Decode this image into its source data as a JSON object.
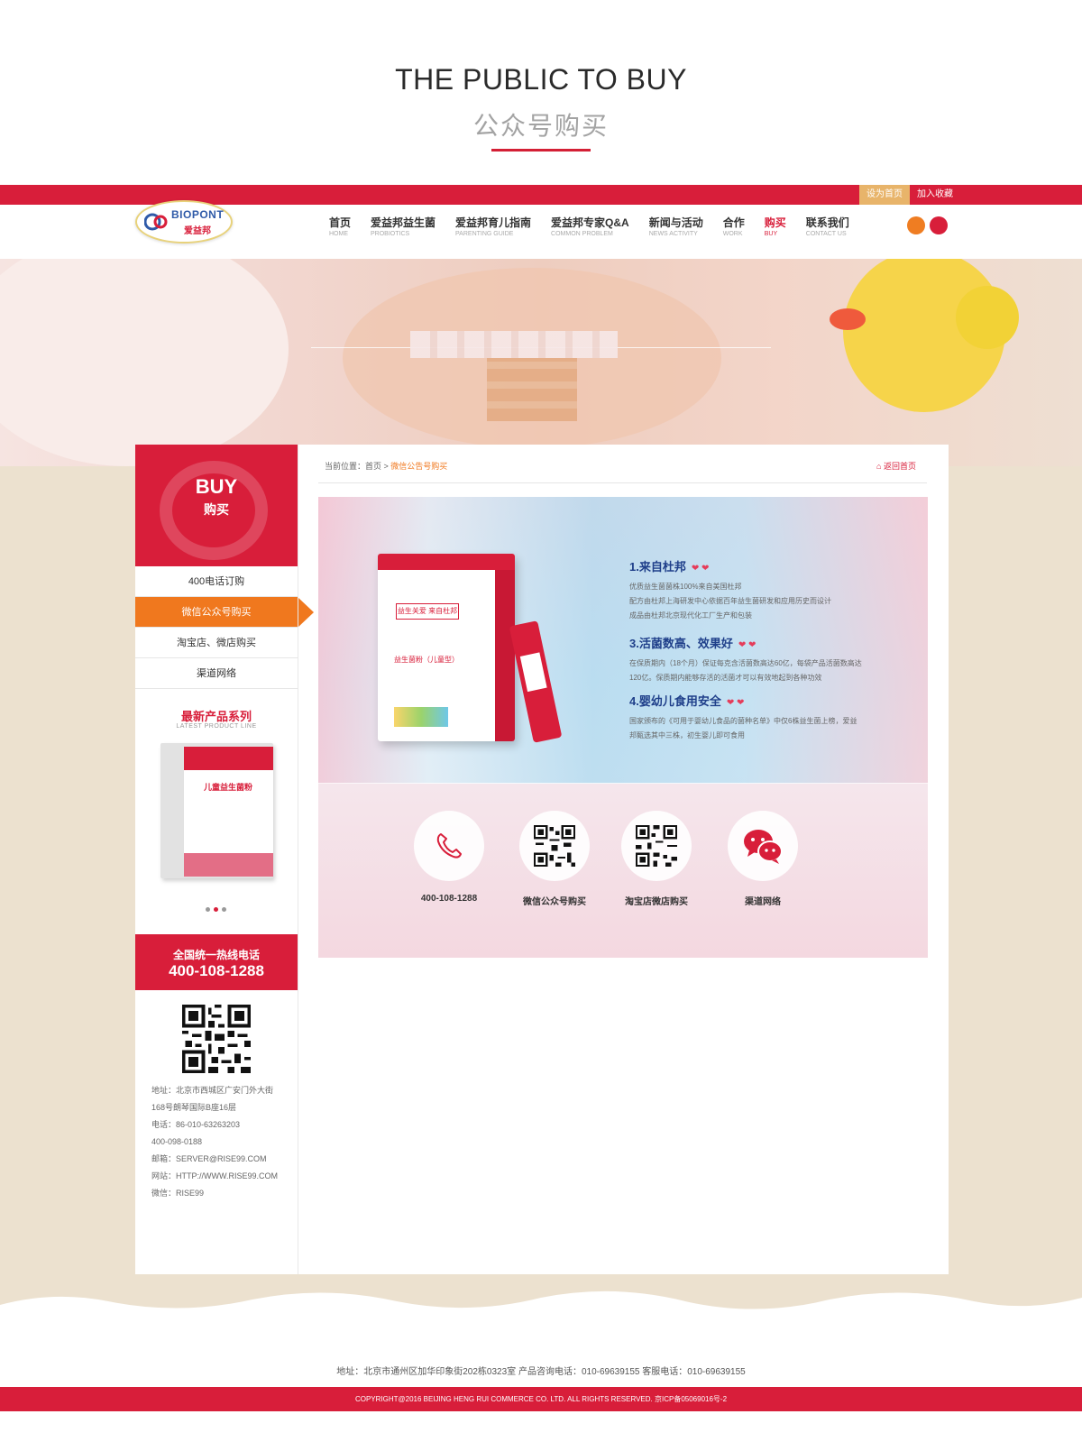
{
  "intro": {
    "title_en": "THE PUBLIC TO BUY",
    "title_cn": "公众号购买"
  },
  "topbar": {
    "set_home": "设为首页",
    "add_favorite": "加入收藏"
  },
  "logo": {
    "brand": "BIOPONT",
    "brand_cn": "爱益邦"
  },
  "nav": [
    {
      "cn": "首页",
      "en": "HOME"
    },
    {
      "cn": "爱益邦益生菌",
      "en": "PROBIOTICS"
    },
    {
      "cn": "爱益邦育儿指南",
      "en": "PARENTING GUIDE"
    },
    {
      "cn": "爱益邦专家Q&A",
      "en": "COMMON PROBLEM"
    },
    {
      "cn": "新闻与活动",
      "en": "NEWS ACTIVITY"
    },
    {
      "cn": "合作",
      "en": "WORK"
    },
    {
      "cn": "购买",
      "en": "BUY",
      "active": true
    },
    {
      "cn": "联系我们",
      "en": "CONTACT US"
    }
  ],
  "sidebar": {
    "head_en": "BUY",
    "head_cn": "购买",
    "items": [
      "400电话订购",
      "微信公众号购买",
      "淘宝店、微店购买",
      "渠道网络"
    ],
    "active_index": 1,
    "latest_title": "最新产品系列",
    "latest_subtitle": "LATEST PRODUCT LINE",
    "latest_product": "儿童益生菌粉",
    "hotline_label": "全国统一热线电话",
    "hotline_number": "400-108-1288",
    "contact": [
      "地址：北京市西城区广安门外大街",
      "168号朗琴国际B座16层",
      "电话：86-010-63263203",
      "400-098-0188",
      "邮箱：SERVER@RISE99.COM",
      "网站：HTTP://WWW.RISE99.COM",
      "微信：RISE99"
    ]
  },
  "breadcrumb": {
    "prefix": "当前位置：首页 > ",
    "current": "微信公告号购买",
    "back": "返回首页"
  },
  "promo": {
    "box_slogan": "益生关爱 来自杜邦",
    "box_product": "益生菌粉（儿童型）",
    "features": [
      {
        "title": "1.来自杜邦",
        "lines": [
          "优质益生菌菌株100%来自美国杜邦",
          "配方由杜邦上海研发中心依据百年益生菌研发和应用历史而设计",
          "成品由杜邦北京现代化工厂生产和包装"
        ]
      },
      {
        "title": "3.活菌数高、效果好",
        "lines": [
          "在保质期内（18个月）保证每克含活菌数高达60亿，每袋产品活菌数高达",
          "120亿。保质期内能够存活的活菌才可以有效地起到各种功效"
        ]
      },
      {
        "title": "4.婴幼儿食用安全",
        "lines": [
          "国家颁布的《可用于婴幼儿食品的菌种名单》中仅6株益生菌上榜，爱益",
          "邦甄选其中三株，初生婴儿即可食用"
        ]
      }
    ],
    "contacts": [
      {
        "label": "400-108-1288",
        "icon": "phone-icon"
      },
      {
        "label": "微信公众号购买",
        "icon": "qr-code-icon"
      },
      {
        "label": "淘宝店微店购买",
        "icon": "qr-code-icon"
      },
      {
        "label": "渠道网络",
        "icon": "chat-bubbles-icon"
      }
    ]
  },
  "footer": {
    "address": "地址：北京市通州区加华印象街202栋0323室   产品咨询电话：010-69639155  客服电话：010-69639155",
    "copyright": "COPYRIGHT@2016 BEIJING HENG RUI COMMERCE CO. LTD. ALL RIGHTS RESERVED. 京ICP备05069016号-2"
  },
  "colors": {
    "brand_red": "#d81e3a",
    "accent_orange": "#f0781e",
    "page_beige": "#ece1cf",
    "feature_blue": "#1f3f8a"
  }
}
